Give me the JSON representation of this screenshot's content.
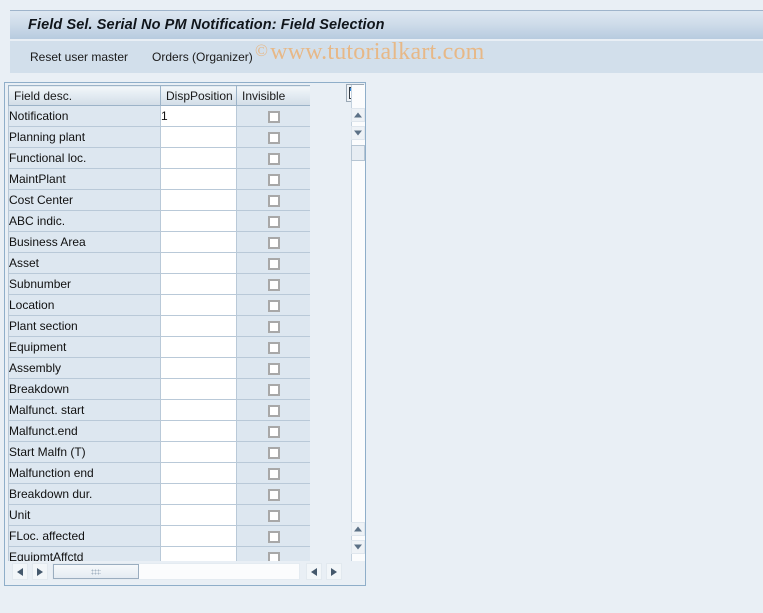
{
  "window": {
    "title": "Field Sel. Serial No PM Notification: Field Selection"
  },
  "toolbar": {
    "reset_label": "Reset user master",
    "orders_label": "Orders (Organizer)"
  },
  "watermark": {
    "symbol": "©",
    "text": "www.tutorialkart.com",
    "color": "#e7b887"
  },
  "table": {
    "columns": [
      "Field desc.",
      "DispPosition",
      "Invisible"
    ],
    "config_icon": "column-config-icon",
    "rows": [
      {
        "desc": "Notification",
        "pos": "1",
        "invisible": false
      },
      {
        "desc": "Planning plant",
        "pos": "",
        "invisible": false
      },
      {
        "desc": "Functional loc.",
        "pos": "",
        "invisible": false
      },
      {
        "desc": "MaintPlant",
        "pos": "",
        "invisible": false
      },
      {
        "desc": "Cost Center",
        "pos": "",
        "invisible": false
      },
      {
        "desc": "ABC indic.",
        "pos": "",
        "invisible": false
      },
      {
        "desc": "Business Area",
        "pos": "",
        "invisible": false
      },
      {
        "desc": "Asset",
        "pos": "",
        "invisible": false
      },
      {
        "desc": "Subnumber",
        "pos": "",
        "invisible": false
      },
      {
        "desc": "Location",
        "pos": "",
        "invisible": false
      },
      {
        "desc": "Plant section",
        "pos": "",
        "invisible": false
      },
      {
        "desc": "Equipment",
        "pos": "",
        "invisible": false
      },
      {
        "desc": "Assembly",
        "pos": "",
        "invisible": false
      },
      {
        "desc": "Breakdown",
        "pos": "",
        "invisible": false
      },
      {
        "desc": "Malfunct. start",
        "pos": "",
        "invisible": false
      },
      {
        "desc": "Malfunct.end",
        "pos": "",
        "invisible": false
      },
      {
        "desc": "Start Malfn (T)",
        "pos": "",
        "invisible": false
      },
      {
        "desc": "Malfunction end",
        "pos": "",
        "invisible": false
      },
      {
        "desc": "Breakdown dur.",
        "pos": "",
        "invisible": false
      },
      {
        "desc": "Unit",
        "pos": "",
        "invisible": false
      },
      {
        "desc": "FLoc. affected",
        "pos": "",
        "invisible": false
      },
      {
        "desc": "EquipmtAffctd",
        "pos": "",
        "invisible": false
      }
    ]
  },
  "scrollbars": {
    "vertical_up": "▲",
    "vertical_down": "▼",
    "horizontal_left": "◀",
    "horizontal_right": "▶"
  },
  "colors": {
    "page_bg": "#e9eff5",
    "titlebar_top": "#dde7f1",
    "titlebar_bottom": "#b7cbdf",
    "toolbar_bg": "#d2dfeb",
    "row_bg": "#dde7f0",
    "input_bg": "#ffffff",
    "panel_border": "#8faec9"
  }
}
